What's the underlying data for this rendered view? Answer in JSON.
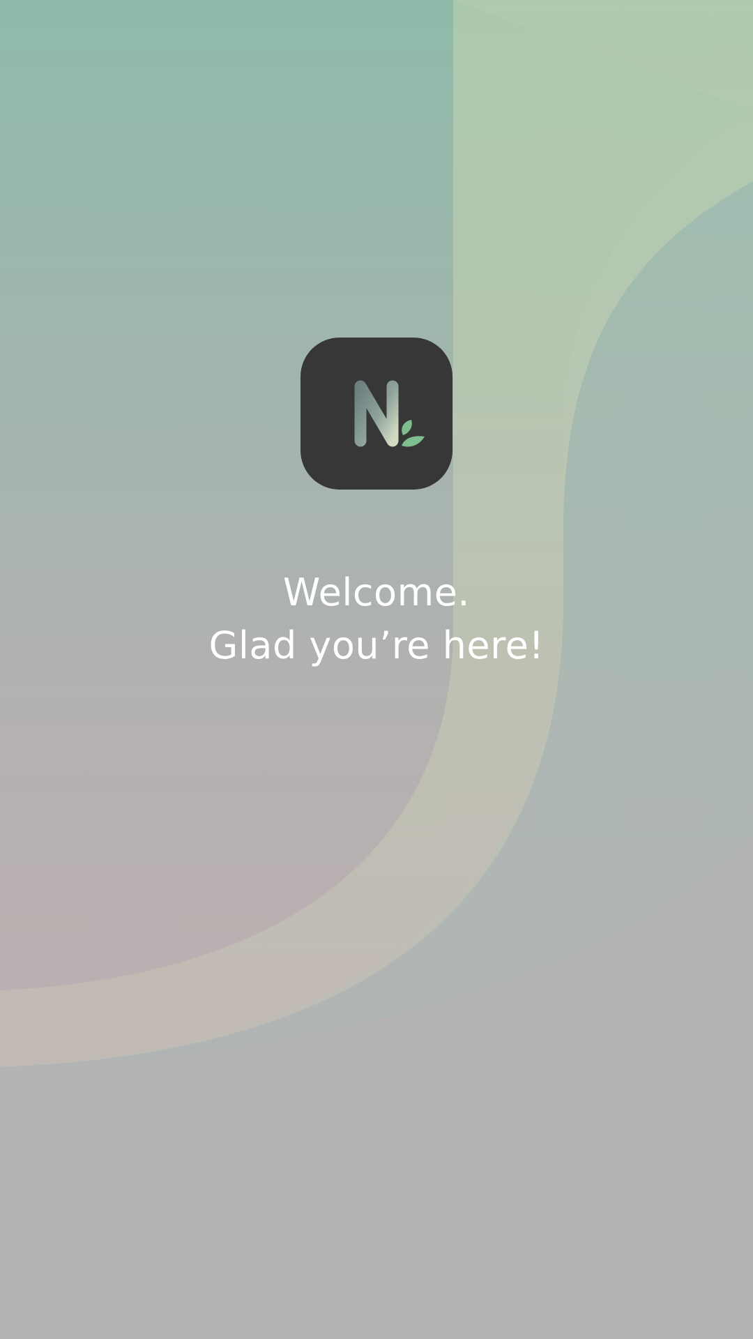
{
  "welcome": {
    "line1": "Welcome.",
    "line2": "Glad you’re here!"
  },
  "logo": {
    "icon": "app-logo-n-leaf-icon",
    "tile_color": "#373737",
    "leaf_color": "#7fbf8f"
  },
  "theme": {
    "text_color": "#ffffff",
    "background_top": "#8ebaaa",
    "background_bottom": "#b6b1b3"
  }
}
